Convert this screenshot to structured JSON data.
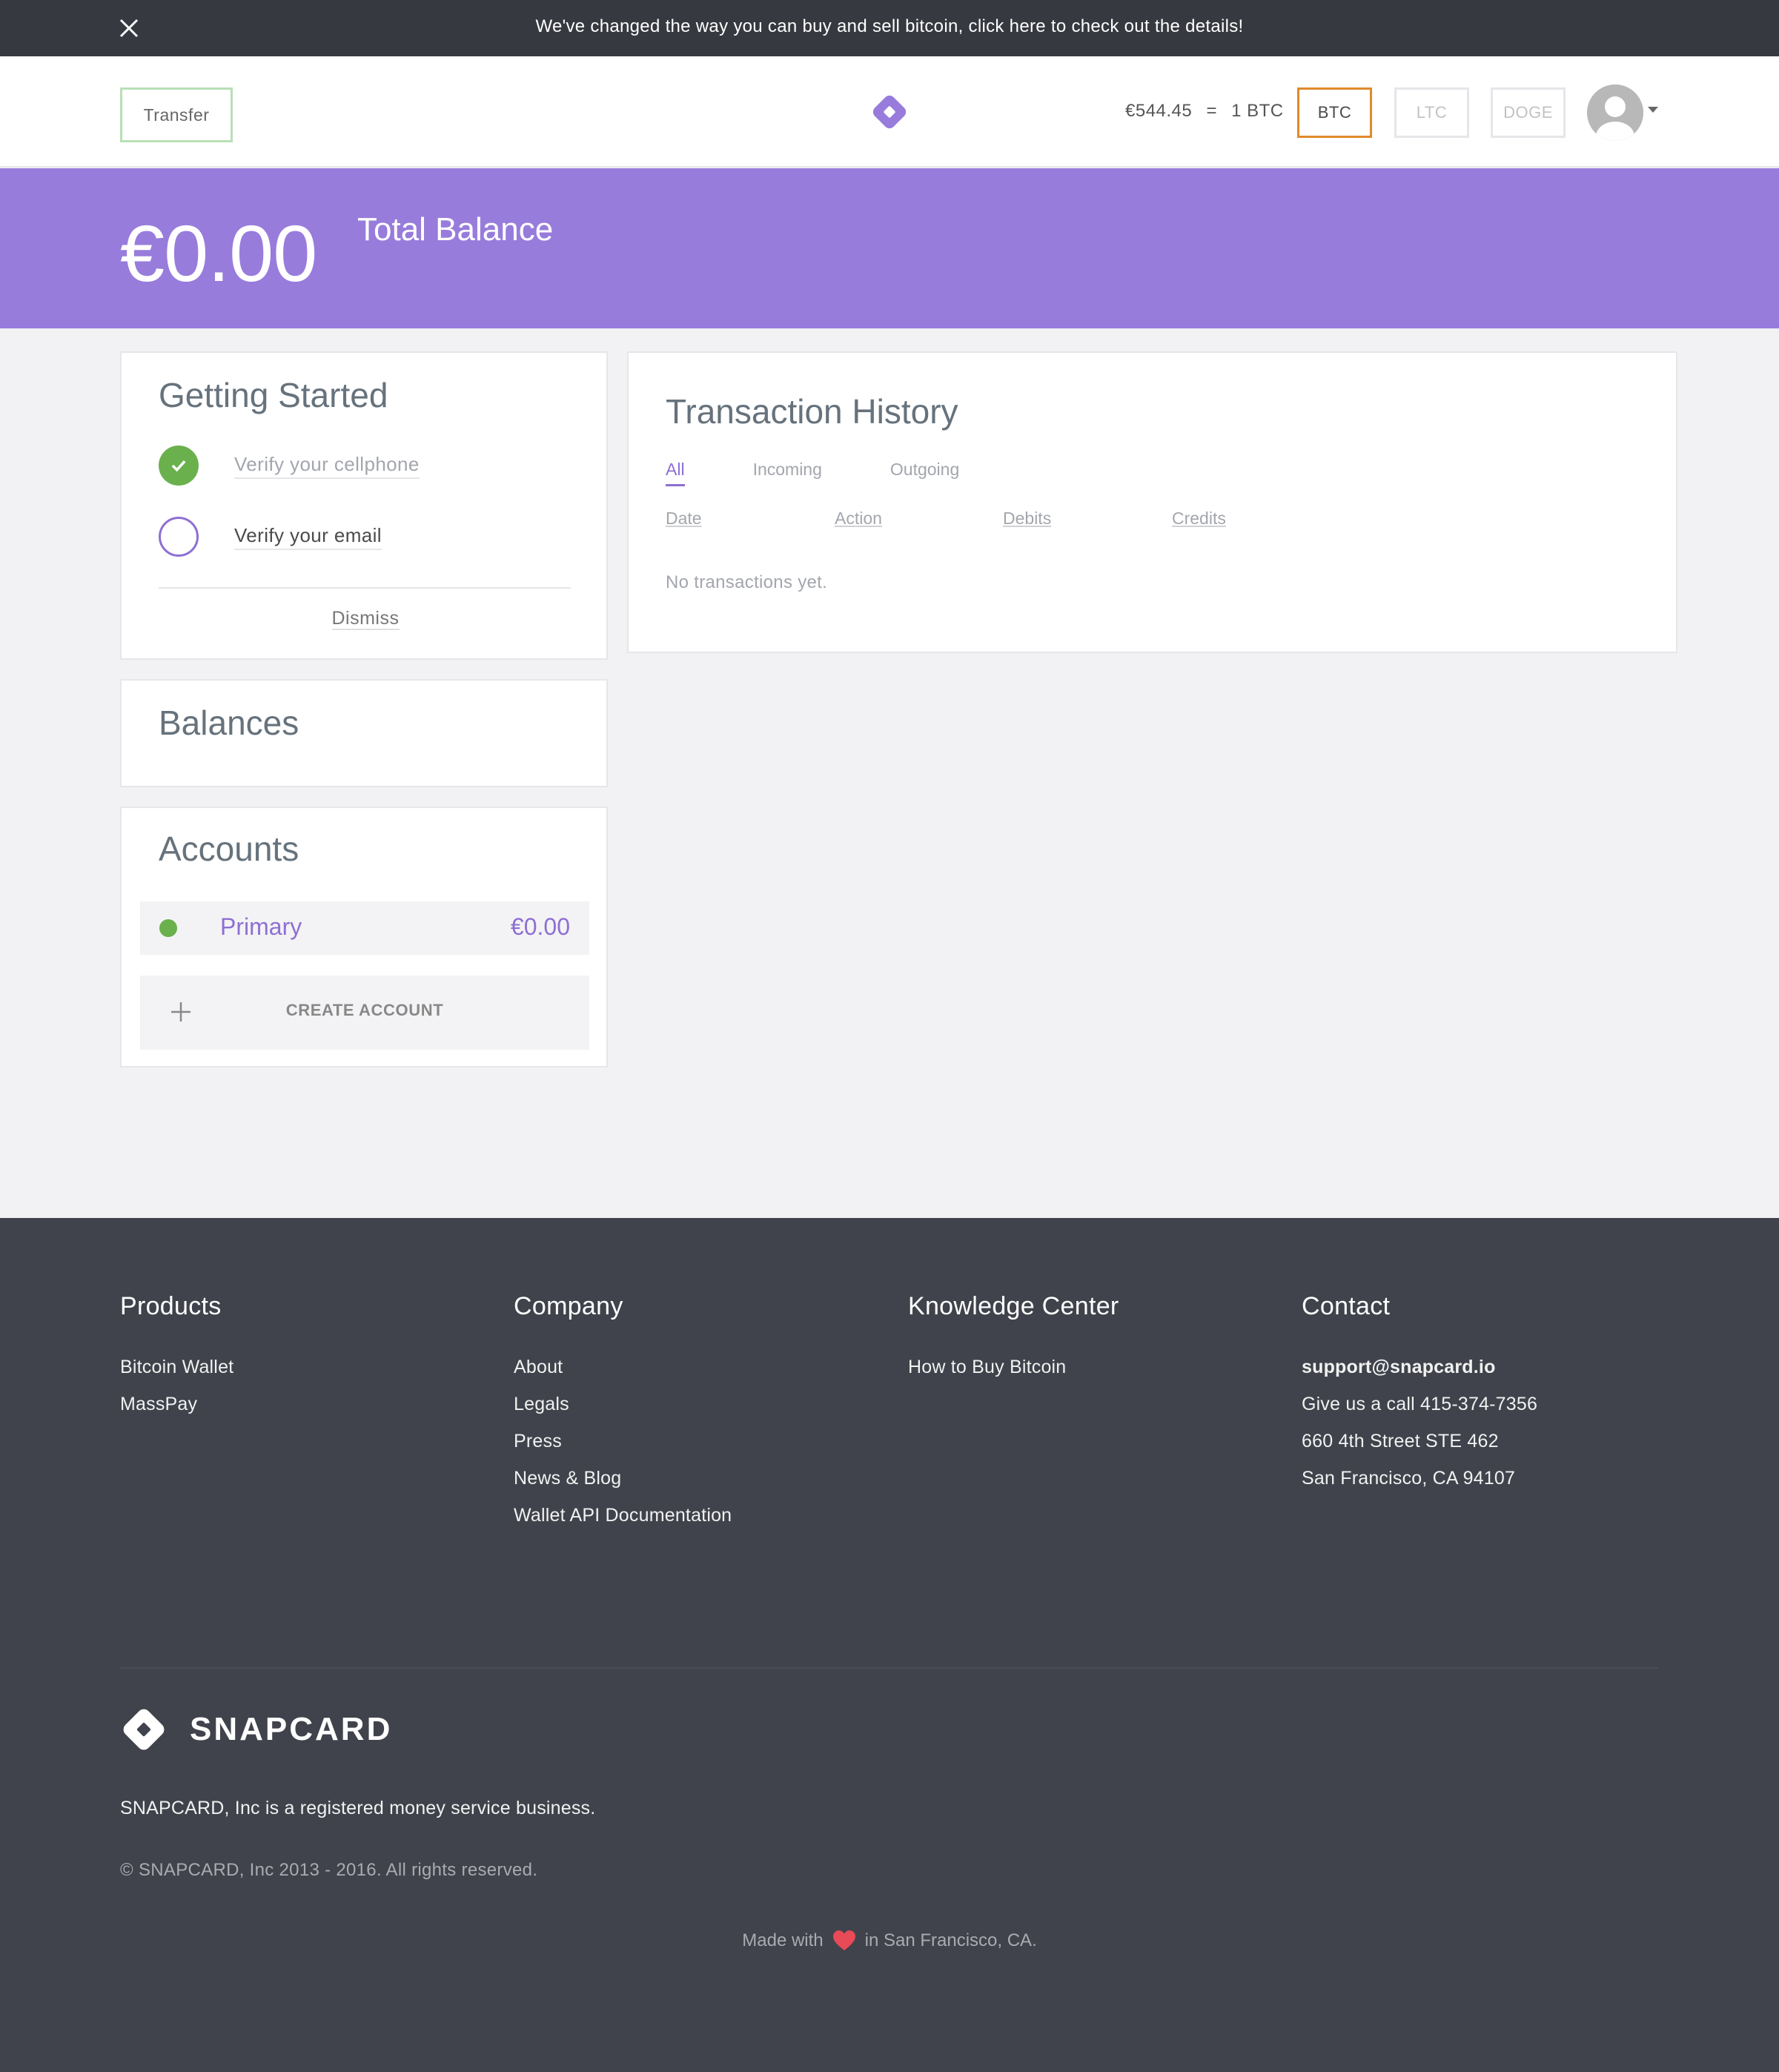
{
  "announcement": {
    "message": "We've changed the way you can buy and sell bitcoin, click here to check out the details!"
  },
  "header": {
    "transfer_label": "Transfer",
    "rate": {
      "fiat": "€544.45",
      "equals": "=",
      "crypto": "1 BTC"
    },
    "currencies": [
      "BTC",
      "LTC",
      "DOGE"
    ],
    "selected_currency": "BTC"
  },
  "banner": {
    "amount": "€0.00",
    "label": "Total Balance"
  },
  "getting_started": {
    "title": "Getting Started",
    "items": [
      {
        "label": "Verify your cellphone",
        "done": true
      },
      {
        "label": "Verify your email",
        "done": false
      }
    ],
    "dismiss": "Dismiss"
  },
  "balances": {
    "title": "Balances"
  },
  "accounts": {
    "title": "Accounts",
    "items": [
      {
        "name": "Primary",
        "value": "€0.00"
      }
    ],
    "create_label": "CREATE ACCOUNT"
  },
  "transactions": {
    "title": "Transaction History",
    "tabs": [
      "All",
      "Incoming",
      "Outgoing"
    ],
    "active_tab": "All",
    "columns": [
      "Date",
      "Action",
      "Debits",
      "Credits"
    ],
    "empty": "No transactions yet."
  },
  "footer": {
    "products": {
      "title": "Products",
      "links": [
        "Bitcoin Wallet",
        "MassPay"
      ]
    },
    "company": {
      "title": "Company",
      "links": [
        "About",
        "Legals",
        "Press",
        "News & Blog",
        "Wallet API Documentation"
      ]
    },
    "knowledge": {
      "title": "Knowledge Center",
      "links": [
        "How to Buy Bitcoin"
      ]
    },
    "contact": {
      "title": "Contact",
      "email": "support@snapcard.io",
      "phone": "Give us a call 415-374-7356",
      "address1": "660 4th Street STE 462",
      "address2": "San Francisco, CA 94107"
    },
    "brand": "SNAPCARD",
    "registered": "SNAPCARD, Inc is a registered money service business.",
    "copyright": "© SNAPCARD, Inc 2013 - 2016. All rights reserved.",
    "made_with_prefix": "Made with",
    "made_with_suffix": "in San Francisco, CA."
  },
  "colors": {
    "accent": "#977cdc",
    "accent_text": "#8e6fd3",
    "success": "#6ab04c",
    "btc_border": "#e08a2c",
    "footer_bg": "#40434b",
    "top_bar_bg": "#36393f"
  },
  "icons": {
    "close": "close-icon",
    "logo": "snapcard-logo-icon",
    "avatar": "user-avatar-icon",
    "check": "check-icon",
    "plus": "plus-icon",
    "heart": "heart-icon"
  }
}
